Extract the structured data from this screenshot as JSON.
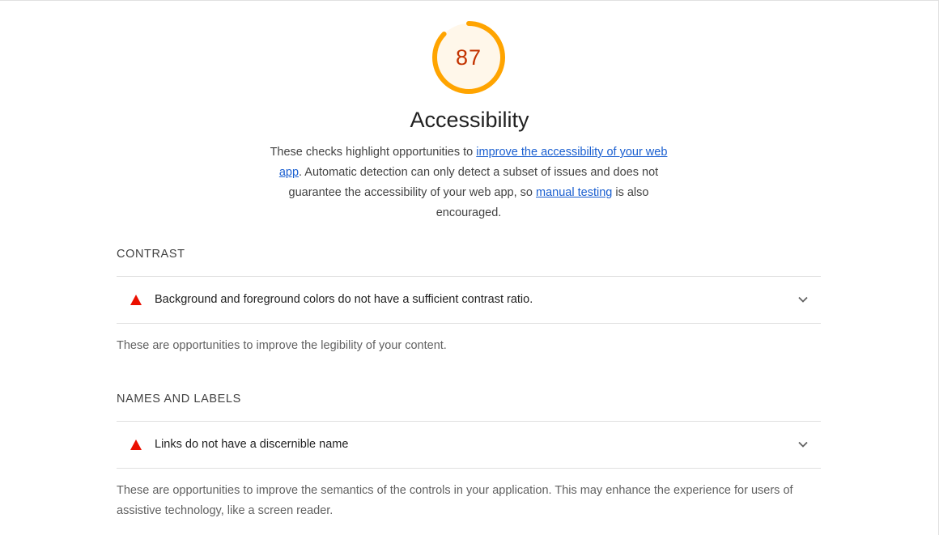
{
  "score": {
    "value": "87",
    "fraction": 0.87,
    "color": "#ffa400",
    "bg": "#fff7ea",
    "text_color": "#c33300"
  },
  "category": {
    "title": "Accessibility",
    "description": {
      "part1": "These checks highlight opportunities to ",
      "link1": "improve the accessibility of your web app",
      "part2": ". Automatic detection can only detect a subset of issues and does not guarantee the accessibility of your web app, so ",
      "link2": "manual testing",
      "part3": " is also encouraged."
    }
  },
  "groups": [
    {
      "title": "CONTRAST",
      "audit": {
        "title": "Background and foreground colors do not have a sufficient contrast ratio.",
        "icon": "warning-triangle-icon"
      },
      "description": "These are opportunities to improve the legibility of your content."
    },
    {
      "title": "NAMES AND LABELS",
      "audit": {
        "title": "Links do not have a discernible name",
        "icon": "warning-triangle-icon"
      },
      "description": "These are opportunities to improve the semantics of the controls in your application. This may enhance the experience for users of assistive technology, like a screen reader."
    }
  ],
  "colors": {
    "fail": "#eb0f00",
    "link": "#1a5fd0"
  }
}
